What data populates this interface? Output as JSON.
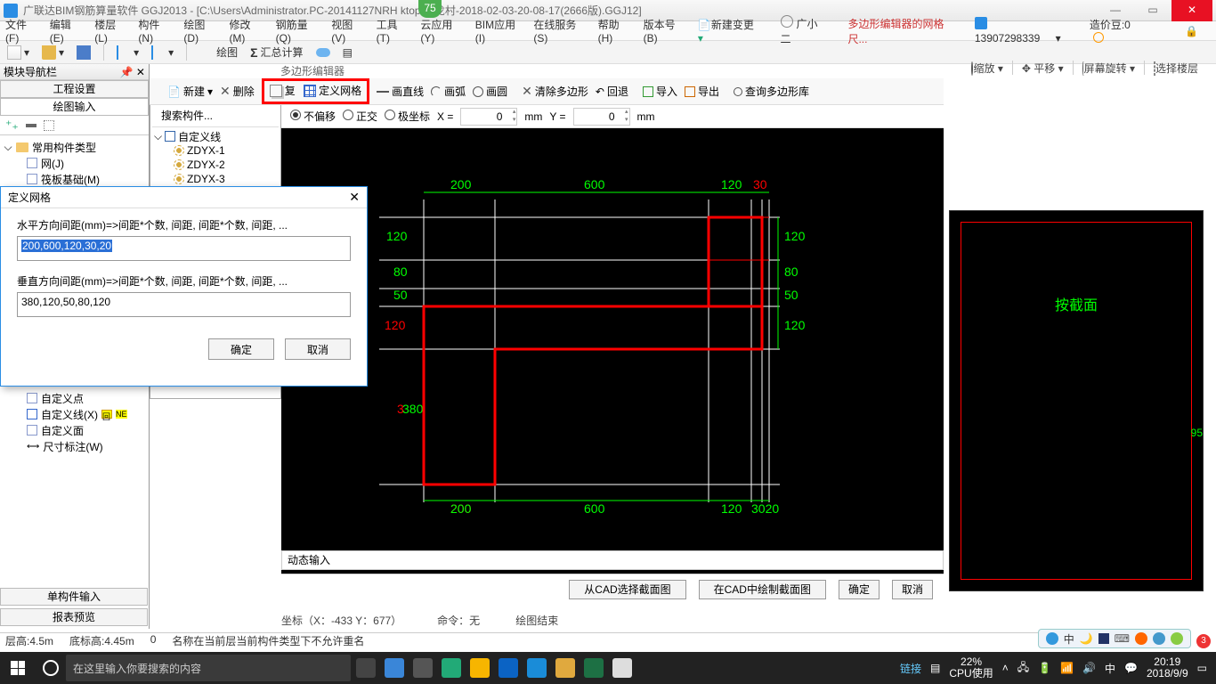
{
  "title": "广联达BIM钢筋算量软件 GGJ2013 - [C:\\Users\\Administrator.PC-20141127NRH    ktop\\白龙村-2018-02-03-20-08-17(2666版).GGJ12]",
  "badge75": "75",
  "menus": {
    "file": "文件(F)",
    "edit": "编辑(E)",
    "floor": "楼层(L)",
    "component": "构件(N)",
    "draw": "绘图(D)",
    "modify": "修改(M)",
    "rebar": "钢筋量(Q)",
    "view": "视图(V)",
    "tool": "工具(T)",
    "cloud": "云应用(Y)",
    "bim": "BIM应用(I)",
    "online": "在线服务(S)",
    "help": "帮助(H)",
    "version": "版本号(B)",
    "newchange": "新建变更",
    "avatar_name": "广小二",
    "redtext": "多边形编辑器的网格尺...",
    "userphone": "13907298339",
    "beans_label": "造价豆:0",
    "lock": "🔒"
  },
  "toolbar1": {
    "draw": "绘图",
    "sum": "汇总计算"
  },
  "poly_title": "多边形编辑器",
  "polybar": {
    "new": "新建",
    "del": "删除",
    "copy": "复",
    "gridbtn": "定义网格",
    "line": "画直线",
    "arc": "画弧",
    "circle": "画圆",
    "cleardel": "清除多边形",
    "back": "回退",
    "sep": "|",
    "import": "导入",
    "export": "导出",
    "query": "查询多边形库"
  },
  "coordbar": {
    "search_ph": "搜索构件...",
    "r1": "不偏移",
    "r2": "正交",
    "r3": "极坐标",
    "xlabel": "X =",
    "xval": "0",
    "mm1": "mm",
    "ylabel": "Y =",
    "yval": "0",
    "mm2": "mm"
  },
  "rt_tools": {
    "zoom": "缩放",
    "pan": "平移",
    "rotate": "屏幕旋转",
    "selfloor": "选择楼层"
  },
  "leftnav": {
    "head": "模块导航栏",
    "b1": "工程设置",
    "b2": "绘图输入",
    "tree_root": "常用构件类型",
    "tree_items": [
      "网(J)",
      "筏板基础(M)"
    ]
  },
  "comptree": {
    "new": "新建",
    "del": "删",
    "root": "自定义线",
    "items": [
      "ZDYX-1",
      "ZDYX-2",
      "ZDYX-3"
    ]
  },
  "bottom_tree": {
    "i1": "自定义点",
    "i2": "自定义线(X)",
    "i3": "自定义面",
    "i4": "尺寸标注(W)"
  },
  "dialog": {
    "title": "定义网格",
    "lbl1": "水平方向间距(mm)=>间距*个数, 间距, 间距*个数, 间距, ...",
    "val1": "200,600,120,30,20",
    "lbl2": "垂直方向间距(mm)=>间距*个数, 间距, 间距*个数, 间距, ...",
    "val2": "380,120,50,80,120",
    "ok": "确定",
    "cancel": "取消"
  },
  "canvas": {
    "top": {
      "d1": "200",
      "d2": "600",
      "d3": "120",
      "d4": "30"
    },
    "right": {
      "d1": "120",
      "d2": "80",
      "d3": "50",
      "d4": "120"
    },
    "left": {
      "d1": "120",
      "d2": "80",
      "d3": "50",
      "d4": "120",
      "d5": "380",
      "d5b": "380"
    },
    "bottom": {
      "d1": "200",
      "d2": "600",
      "d3": "120",
      "d4": "30",
      "d4b": "20"
    }
  },
  "rightprev": {
    "lbl": "按截面",
    "num": "95"
  },
  "dynbar": "动态输入",
  "botbtns": {
    "b1": "从CAD选择截面图",
    "b2": "在CAD中绘制截面图",
    "ok": "确定",
    "cancel": "取消"
  },
  "statusline": {
    "coord": "坐标（X：-433 Y：677）",
    "cmd": "命令：无",
    "end": "绘图结束"
  },
  "singleinput": "单构件输入",
  "report": "报表预览",
  "floorline": {
    "h": "层高:4.5m",
    "bh": "底标高:4.45m",
    "n": "0",
    "msg": "名称在当前层当前构件类型下不允许重名"
  },
  "taskbar": {
    "search": "在这里输入你要搜索的内容",
    "link": "链接",
    "cpu_pct": "22%",
    "cpu_lbl": "CPU使用",
    "time": "20:19",
    "date": "2018/9/9"
  },
  "ime": {
    "zh": "中",
    "moon": "🌙",
    "j": "Ј"
  },
  "tinybadge": "3"
}
